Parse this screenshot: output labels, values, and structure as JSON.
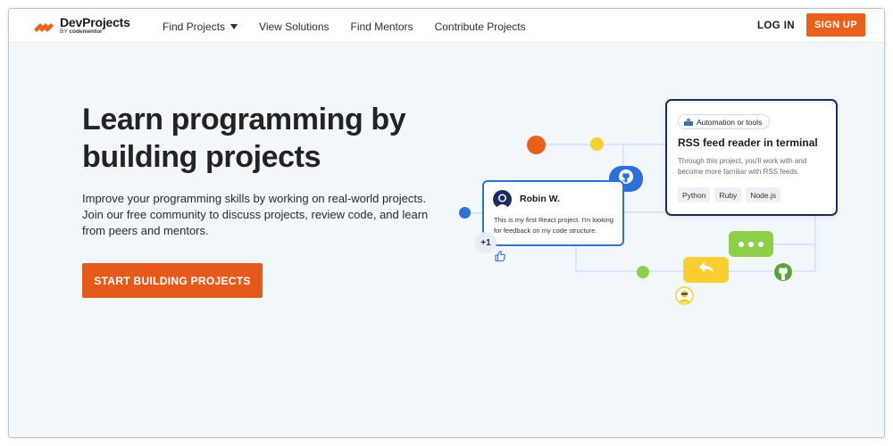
{
  "brand": {
    "name": "DevProjects",
    "by": "BY",
    "by_company": "codementor"
  },
  "nav": {
    "items": [
      {
        "label": "Find Projects",
        "has_dropdown": true
      },
      {
        "label": "View Solutions"
      },
      {
        "label": "Find Mentors"
      },
      {
        "label": "Contribute Projects"
      }
    ],
    "login": "LOG IN",
    "signup": "SIGN UP"
  },
  "hero": {
    "headline": "Learn programming by building projects",
    "description": "Improve your programming skills by working on real-world projects. Join our free community to discuss projects, review code, and learn from peers and mentors.",
    "cta": "START BUILDING PROJECTS"
  },
  "project_card": {
    "tag": "Automation or tools",
    "title": "RSS feed reader in terminal",
    "description": "Through this project, you'll work with and become more familiar with RSS feeds.",
    "chips": [
      "Python",
      "Ruby",
      "Node.js"
    ]
  },
  "comment_card": {
    "name": "Robin W.",
    "text": "This is my first React project. I'm looking for feedback on my code structure.",
    "plus": "+1"
  },
  "colors": {
    "brand_orange": "#e8601c",
    "navy": "#1a2d5c",
    "blue": "#2f6fd8",
    "green": "#8cd04a",
    "yellow": "#f7cf31",
    "background": "#f2f7fc"
  },
  "icons": [
    "logo-mark-icon",
    "caret-down-icon",
    "gear-icon",
    "github-icon",
    "thumbs-up-icon",
    "reply-icon",
    "more-dots-icon",
    "avatar-icon"
  ]
}
